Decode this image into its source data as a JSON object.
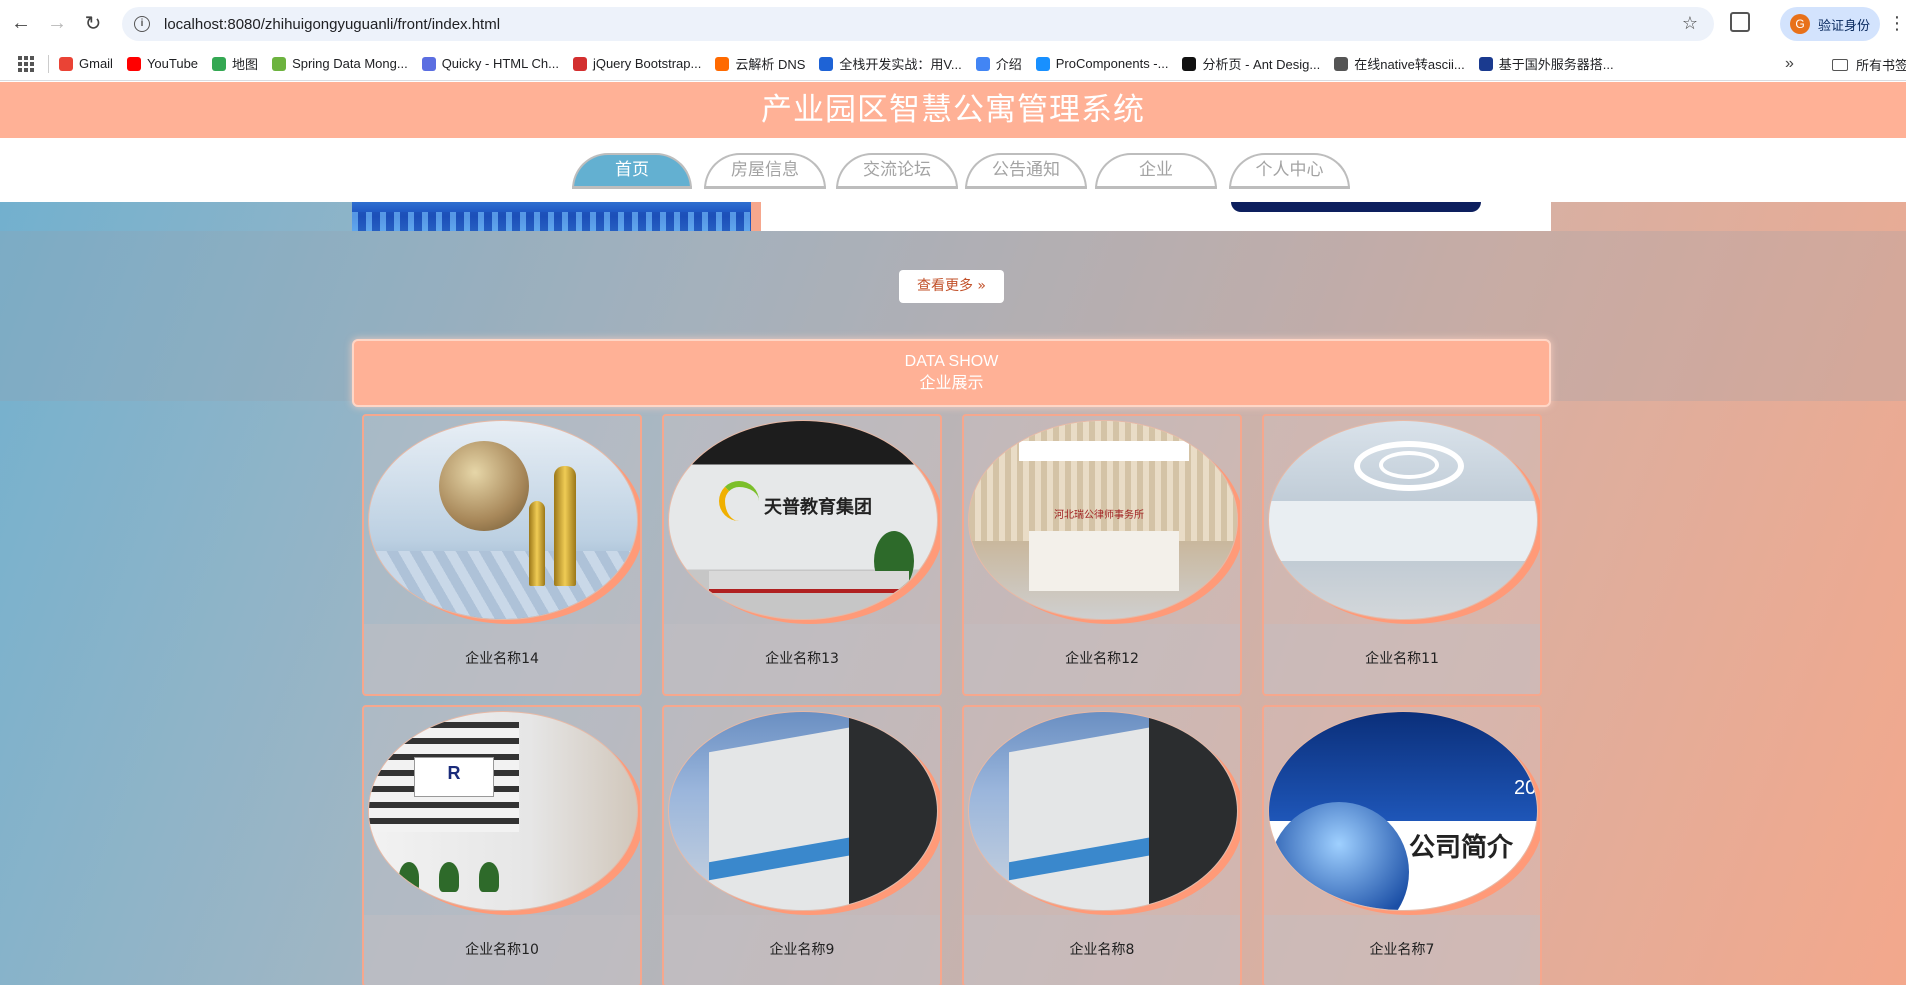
{
  "browser": {
    "url": "localhost:8080/zhihuigongyuguanli/front/index.html",
    "profile_label": "验证身份",
    "bookmarks": [
      {
        "label": "Gmail",
        "color": "#ea4335"
      },
      {
        "label": "YouTube",
        "color": "#ff0000"
      },
      {
        "label": "地图",
        "color": "#34a853"
      },
      {
        "label": "Spring Data Mong...",
        "color": "#6db33f"
      },
      {
        "label": "Quicky - HTML Ch...",
        "color": "#5b6ee1"
      },
      {
        "label": "jQuery Bootstrap...",
        "color": "#d32f2f"
      },
      {
        "label": "云解析 DNS",
        "color": "#ff6a00"
      },
      {
        "label": "全栈开发实战：用V...",
        "color": "#1e63d6"
      },
      {
        "label": "介绍",
        "color": "#4285f4"
      },
      {
        "label": "ProComponents -...",
        "color": "#1890ff"
      },
      {
        "label": "分析页 - Ant Desig...",
        "color": "#111111"
      },
      {
        "label": "在线native转ascii...",
        "color": "#555555"
      },
      {
        "label": "基于国外服务器搭...",
        "color": "#1a3a8f"
      }
    ],
    "bookmarks_folder": "所有书签"
  },
  "site": {
    "title": "产业园区智慧公寓管理系统",
    "nav": [
      {
        "label": "首页",
        "active": true
      },
      {
        "label": "房屋信息",
        "active": false
      },
      {
        "label": "交流论坛",
        "active": false
      },
      {
        "label": "公告通知",
        "active": false
      },
      {
        "label": "企业",
        "active": false
      },
      {
        "label": "个人中心",
        "active": false
      }
    ],
    "more_button": "查看更多 »",
    "section_en": "DATA SHOW",
    "section_cn": "企业展示",
    "companies": [
      {
        "name": "企业名称14",
        "scene": "chess"
      },
      {
        "name": "企业名称13",
        "scene": "reception"
      },
      {
        "name": "企业名称12",
        "scene": "lobby"
      },
      {
        "name": "企业名称11",
        "scene": "office"
      },
      {
        "name": "企业名称10",
        "scene": "software"
      },
      {
        "name": "企业名称9",
        "scene": "building"
      },
      {
        "name": "企业名称8",
        "scene": "building"
      },
      {
        "name": "企业名称7",
        "scene": "intro"
      }
    ],
    "photo_text": {
      "reception_logo": "天普教育集团",
      "lobby_sign": "河北瑞公律师事务所",
      "software_logo": "R",
      "intro_title": "公司简介",
      "intro_year": "20"
    }
  },
  "colors": {
    "header_bg": "#ffb196",
    "nav_active": "#63b0d1",
    "card_border": "#f6a78d",
    "more_text": "#c2512a"
  }
}
